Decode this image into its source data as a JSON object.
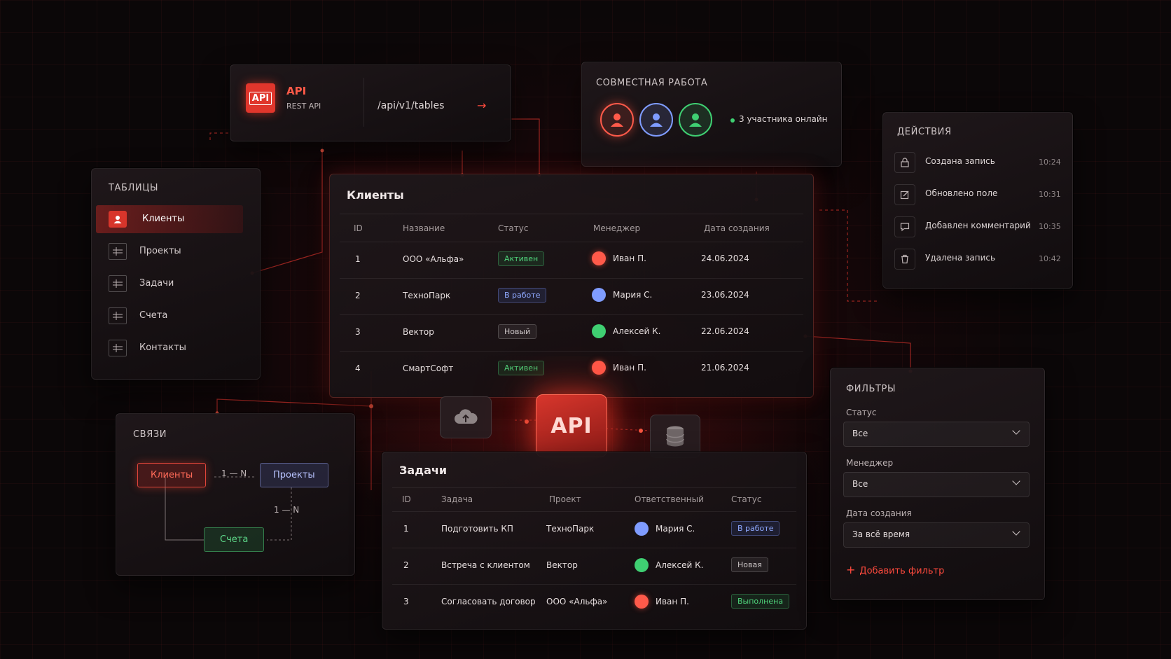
{
  "api_panel": {
    "logo": "API",
    "title": "API",
    "subtitle": "REST API",
    "endpoint": "/api/v1/tables",
    "arrow": "→"
  },
  "collab": {
    "title": "СОВМЕСТНАЯ РАБОТА",
    "online_text": "3 участника онлайн"
  },
  "actions": {
    "title": "ДЕЙСТВИЯ",
    "items": [
      {
        "label": "Создана запись",
        "time": "10:24",
        "icon": "lock-icon"
      },
      {
        "label": "Обновлено поле",
        "time": "10:31",
        "icon": "edit-icon"
      },
      {
        "label": "Добавлен комментарий",
        "time": "10:35",
        "icon": "comment-icon"
      },
      {
        "label": "Удалена запись",
        "time": "10:42",
        "icon": "trash-icon"
      }
    ]
  },
  "tables": {
    "title": "ТАБЛИЦЫ",
    "items": [
      {
        "label": "Клиенты"
      },
      {
        "label": "Проекты"
      },
      {
        "label": "Задачи"
      },
      {
        "label": "Счета"
      },
      {
        "label": "Контакты"
      }
    ]
  },
  "clients": {
    "title": "Клиенты",
    "columns": [
      "ID",
      "Название",
      "Статус",
      "Менеджер",
      "Дата создания"
    ],
    "rows": [
      {
        "id": "1",
        "name": "ООО «Альфа»",
        "status": "Активен",
        "manager": "Иван П.",
        "date": "24.06.2024"
      },
      {
        "id": "2",
        "name": "ТехноПарк",
        "status": "В работе",
        "manager": "Мария С.",
        "date": "23.06.2024"
      },
      {
        "id": "3",
        "name": "Вектор",
        "status": "Новый",
        "manager": "Алексей К.",
        "date": "22.06.2024"
      },
      {
        "id": "4",
        "name": "СмартСофт",
        "status": "Активен",
        "manager": "Иван П.",
        "date": "21.06.2024"
      }
    ]
  },
  "links": {
    "title": "СВЯЗИ",
    "node_clients": "Клиенты",
    "node_projects": "Проекты",
    "node_accounts": "Счета",
    "rel1": "1 — N",
    "rel2": "1 — N"
  },
  "center": {
    "api": "API"
  },
  "tasks": {
    "title": "Задачи",
    "columns": [
      "ID",
      "Задача",
      "Проект",
      "Ответственный",
      "Статус"
    ],
    "rows": [
      {
        "id": "1",
        "task": "Подготовить КП",
        "project": "ТехноПарк",
        "owner": "Мария С.",
        "status": "В работе"
      },
      {
        "id": "2",
        "task": "Встреча с клиентом",
        "project": "Вектор",
        "owner": "Алексей К.",
        "status": "Новая"
      },
      {
        "id": "3",
        "task": "Согласовать договор",
        "project": "ООО «Альфа»",
        "owner": "Иван П.",
        "status": "Выполнена"
      }
    ]
  },
  "filters": {
    "title": "ФИЛЬТРЫ",
    "status_label": "Статус",
    "status_value": "Все",
    "manager_label": "Менеджер",
    "manager_value": "Все",
    "date_label": "Дата создания",
    "date_value": "За всё время",
    "add": "Добавить фильтр"
  },
  "colors": {
    "accent": "#ff4a3d",
    "red_user": "#ff5a4a",
    "blue_user": "#7f9cff",
    "green_user": "#3fcf72"
  }
}
